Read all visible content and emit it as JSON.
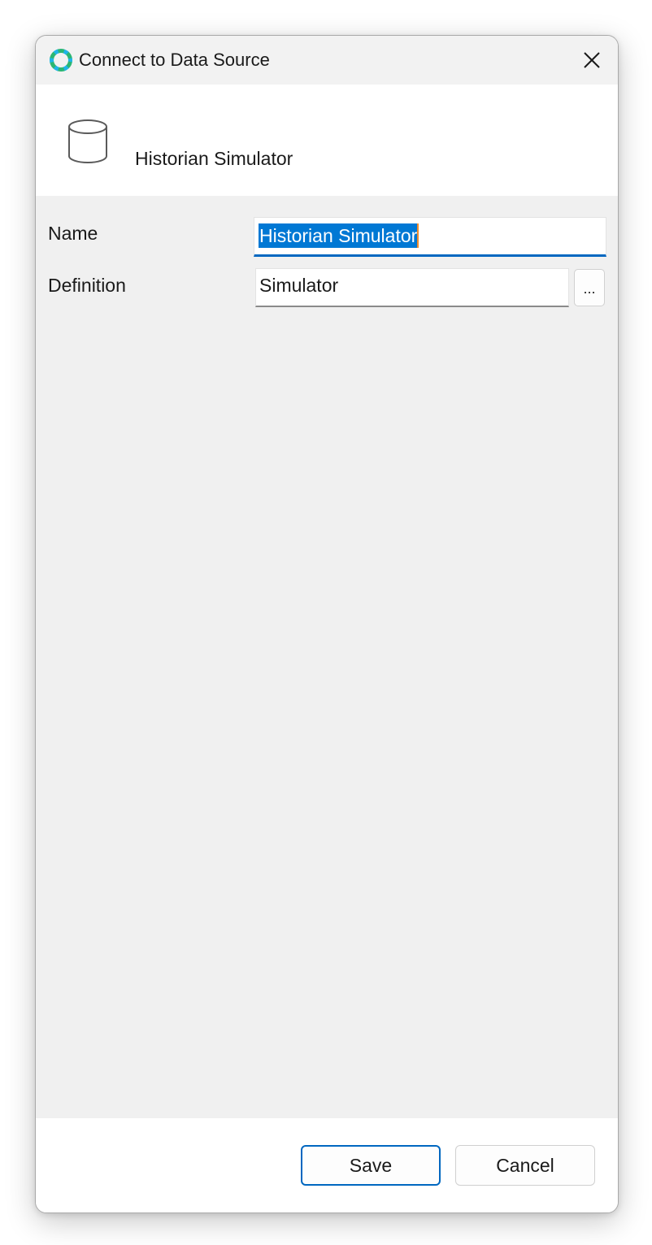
{
  "window": {
    "title": "Connect to Data Source"
  },
  "header": {
    "title": "Historian Simulator",
    "icon": "database-icon"
  },
  "form": {
    "name": {
      "label": "Name",
      "value": "Historian Simulator"
    },
    "definition": {
      "label": "Definition",
      "value": "Simulator",
      "browse_label": "..."
    }
  },
  "footer": {
    "save_label": "Save",
    "cancel_label": "Cancel"
  },
  "colors": {
    "accent": "#0067c0",
    "selection": "#0078d4"
  }
}
